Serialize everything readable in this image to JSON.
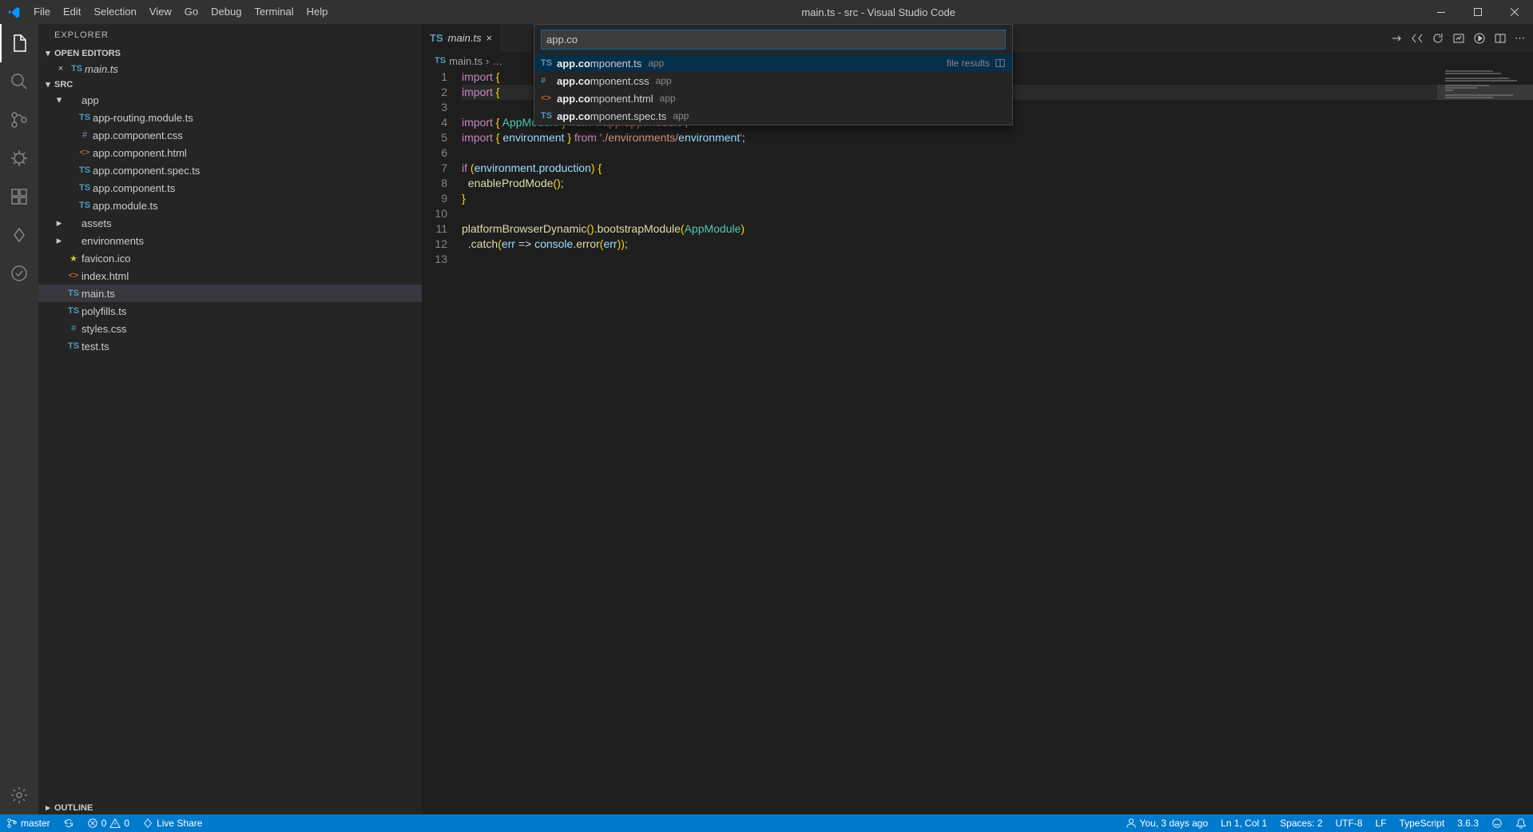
{
  "title": "main.ts - src - Visual Studio Code",
  "menu": [
    "File",
    "Edit",
    "Selection",
    "View",
    "Go",
    "Debug",
    "Terminal",
    "Help"
  ],
  "activity": {
    "items": [
      "files",
      "search",
      "scm",
      "debug",
      "extensions",
      "liveshare",
      "testing"
    ],
    "bottom": [
      "settings"
    ]
  },
  "sidebar": {
    "title": "EXPLORER",
    "sections": {
      "open_editors": {
        "label": "OPEN EDITORS",
        "items": [
          {
            "icon": "ts",
            "name": "main.ts",
            "close": true
          }
        ]
      },
      "src": {
        "label": "SRC",
        "tree": [
          {
            "depth": 0,
            "twisty": "down",
            "icon": "",
            "name": "app"
          },
          {
            "depth": 1,
            "icon": "ts",
            "name": "app-routing.module.ts"
          },
          {
            "depth": 1,
            "icon": "css",
            "name": "app.component.css"
          },
          {
            "depth": 1,
            "icon": "html",
            "name": "app.component.html"
          },
          {
            "depth": 1,
            "icon": "ts",
            "name": "app.component.spec.ts"
          },
          {
            "depth": 1,
            "icon": "ts",
            "name": "app.component.ts"
          },
          {
            "depth": 1,
            "icon": "ts",
            "name": "app.module.ts"
          },
          {
            "depth": 0,
            "twisty": "right",
            "icon": "",
            "name": "assets"
          },
          {
            "depth": 0,
            "twisty": "right",
            "icon": "",
            "name": "environments"
          },
          {
            "depth": 0,
            "icon": "fav",
            "name": "favicon.ico"
          },
          {
            "depth": 0,
            "icon": "html",
            "name": "index.html"
          },
          {
            "depth": 0,
            "icon": "ts",
            "name": "main.ts",
            "selected": true
          },
          {
            "depth": 0,
            "icon": "ts",
            "name": "polyfills.ts"
          },
          {
            "depth": 0,
            "icon": "css",
            "name": "styles.css"
          },
          {
            "depth": 0,
            "icon": "ts",
            "name": "test.ts"
          }
        ]
      },
      "outline": {
        "label": "OUTLINE"
      }
    }
  },
  "tabs": [
    {
      "icon": "ts",
      "name": "main.ts"
    }
  ],
  "breadcrumb": {
    "icon": "ts",
    "name": "main.ts",
    "sep": "›",
    "more": "…"
  },
  "quick_open": {
    "query": "app.co",
    "file_results_label": "file results",
    "items": [
      {
        "icon": "ts",
        "match": "app.co",
        "rest": "mponent.ts",
        "path": "app",
        "sel": true
      },
      {
        "icon": "css",
        "match": "app.co",
        "rest": "mponent.css",
        "path": "app"
      },
      {
        "icon": "html",
        "match": "app.co",
        "rest": "mponent.html",
        "path": "app"
      },
      {
        "icon": "ts",
        "match": "app.co",
        "rest": "mponent.spec.ts",
        "path": "app"
      }
    ]
  },
  "code": {
    "lines": [
      "import { ",
      "import { ",
      "",
      "import { AppModule } from './app/app.module';",
      "import { environment } from './environments/environment';",
      "",
      "if (environment.production) {",
      "  enableProdMode();",
      "}",
      "",
      "platformBrowserDynamic().bootstrapModule(AppModule)",
      "  .catch(err => console.error(err));",
      ""
    ]
  },
  "status": {
    "left": {
      "branch": "master",
      "sync": "",
      "errors": "0",
      "warnings": "0",
      "liveshare": "Live Share"
    },
    "right": {
      "blame": "You, 3 days ago",
      "cursor": "Ln 1, Col 1",
      "spaces": "Spaces: 2",
      "encoding": "UTF-8",
      "eol": "LF",
      "lang": "TypeScript",
      "version": "3.6.3",
      "feedback": "",
      "bell": ""
    }
  }
}
